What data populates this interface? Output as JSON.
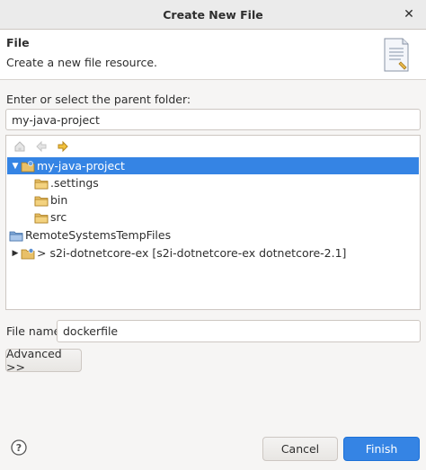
{
  "dialog": {
    "title": "Create New File"
  },
  "header": {
    "title": "File",
    "description": "Create a new file resource."
  },
  "parent": {
    "label": "Enter or select the parent folder:",
    "value": "my-java-project"
  },
  "tree": {
    "items": [
      {
        "label": "my-java-project",
        "selected": true,
        "expanded": true
      },
      {
        "label": ".settings"
      },
      {
        "label": "bin"
      },
      {
        "label": "src"
      },
      {
        "label": "RemoteSystemsTempFiles"
      },
      {
        "label": "> s2i-dotnetcore-ex [s2i-dotnetcore-ex dotnetcore-2.1]",
        "expanded": false
      }
    ]
  },
  "filename": {
    "label": "File name:",
    "value": "dockerfile"
  },
  "buttons": {
    "advanced": "Advanced >>",
    "cancel": "Cancel",
    "finish": "Finish"
  },
  "colors": {
    "selection": "#3584e4",
    "folder": "#d9a633"
  }
}
